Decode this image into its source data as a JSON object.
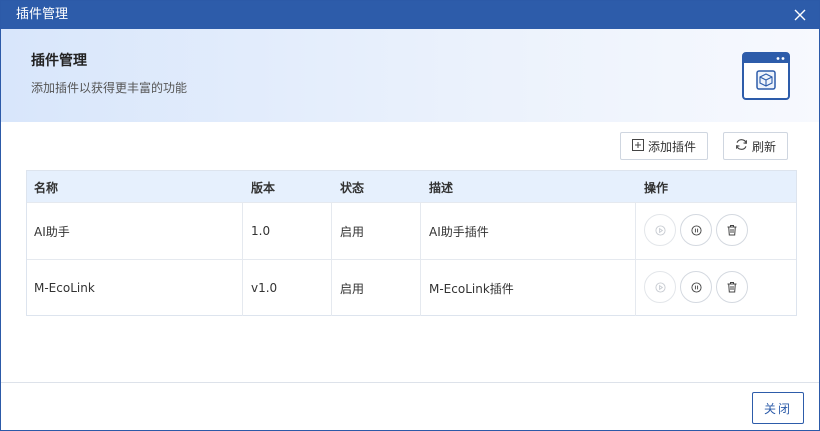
{
  "dialog": {
    "title": "插件管理",
    "close_icon": "close-icon"
  },
  "banner": {
    "title": "插件管理",
    "subtitle": "添加插件以获得更丰富的功能",
    "icon": "plugin-window-icon"
  },
  "toolbar": {
    "add_label": "添加插件",
    "refresh_label": "刷新"
  },
  "table": {
    "columns": [
      "名称",
      "版本",
      "状态",
      "描述",
      "操作"
    ],
    "rows": [
      {
        "name": "AI助手",
        "version": "1.0",
        "status": "启用",
        "description": "AI助手插件"
      },
      {
        "name": "M-EcoLink",
        "version": "v1.0",
        "status": "启用",
        "description": "M-EcoLink插件"
      }
    ],
    "actions": [
      "play-icon",
      "stop-icon",
      "trash-icon"
    ]
  },
  "footer": {
    "close_label": "关闭"
  },
  "colors": {
    "primary": "#2d5caa",
    "header_bg": "#e6f0fd"
  }
}
